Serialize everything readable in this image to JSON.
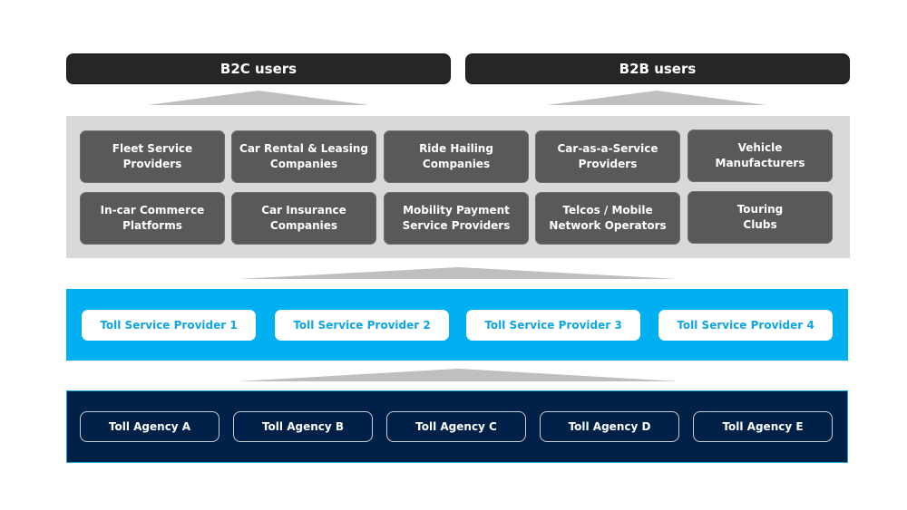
{
  "user_groups": {
    "b2c": "B2C users",
    "b2b": "B2B users"
  },
  "service_categories": [
    {
      "line1": "Fleet Service",
      "line2": "Providers"
    },
    {
      "line1": "Car Rental & Leasing",
      "line2": "Companies"
    },
    {
      "line1": "Ride Hailing",
      "line2": "Companies"
    },
    {
      "line1": "Car-as-a-Service",
      "line2": "Providers"
    },
    {
      "line1": "Vehicle",
      "line2": "Manufacturers"
    },
    {
      "line1": "In-car Commerce",
      "line2": "Platforms"
    },
    {
      "line1": "Car Insurance",
      "line2": "Companies"
    },
    {
      "line1": "Mobility Payment",
      "line2": "Service Providers"
    },
    {
      "line1": "Telcos / Mobile",
      "line2": "Network Operators"
    },
    {
      "line1": "Touring",
      "line2": "Clubs"
    }
  ],
  "toll_service_providers": [
    "Toll Service Provider 1",
    "Toll Service Provider 2",
    "Toll Service Provider 3",
    "Toll Service Provider 4"
  ],
  "toll_agencies": [
    "Toll Agency A",
    "Toll Agency B",
    "Toll Agency C",
    "Toll Agency D",
    "Toll Agency E"
  ],
  "colors": {
    "user_bar": "#262626",
    "category_panel": "#d9d9d9",
    "category_tile": "#595959",
    "tsp_panel": "#00b0f0",
    "tsp_text": "#0ea5e6",
    "agency_panel": "#002147",
    "connector": "#bfbfbf"
  }
}
